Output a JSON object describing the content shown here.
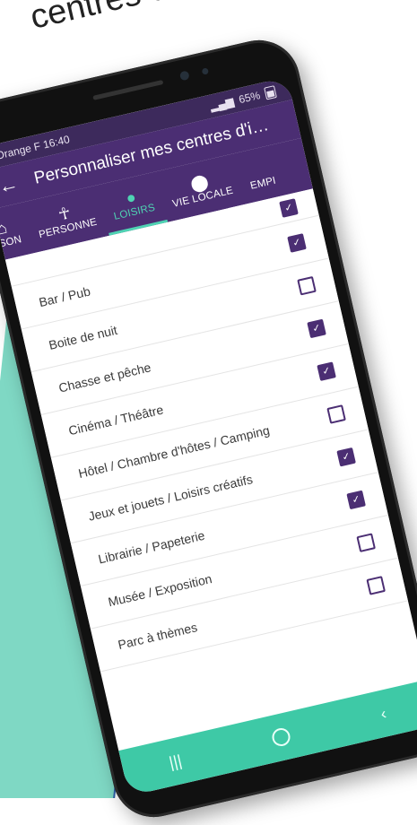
{
  "headline": "centres d'intérêts",
  "status": {
    "carrier": "Orange F",
    "time": "16:40",
    "battery": "65%"
  },
  "appbar": {
    "back_icon": "arrow-back-icon",
    "title": "Personnaliser mes centres d'i…"
  },
  "tabs": [
    {
      "label": "AISON",
      "icon": "home-icon",
      "active": false
    },
    {
      "label": "PERSONNE",
      "icon": "person-icon",
      "active": false
    },
    {
      "label": "LOISIRS",
      "icon": "palette-icon",
      "active": true
    },
    {
      "label": "VIE LOCALE",
      "icon": "location-pin-icon",
      "active": false
    },
    {
      "label": "EMPI",
      "icon": "",
      "active": false
    }
  ],
  "items": [
    {
      "label": "Bar / Pub",
      "checked": true
    },
    {
      "label": "Boite de nuit",
      "checked": false
    },
    {
      "label": "Chasse et pêche",
      "checked": true
    },
    {
      "label": "Cinéma / Théâtre",
      "checked": true
    },
    {
      "label": "Hôtel / Chambre d'hôtes / Camping",
      "checked": false
    },
    {
      "label": "Jeux et jouets / Loisirs créatifs",
      "checked": true
    },
    {
      "label": "Librairie / Papeterie",
      "checked": true
    },
    {
      "label": "Musée / Exposition",
      "checked": false
    },
    {
      "label": "Parc à thèmes",
      "checked": false
    }
  ],
  "navbar": {
    "recents_icon": "recents-icon",
    "home_icon": "home-button-icon"
  },
  "colors": {
    "primary": "#4b2e73",
    "accent": "#3ec9a6",
    "panel": "#7fd8c4"
  }
}
